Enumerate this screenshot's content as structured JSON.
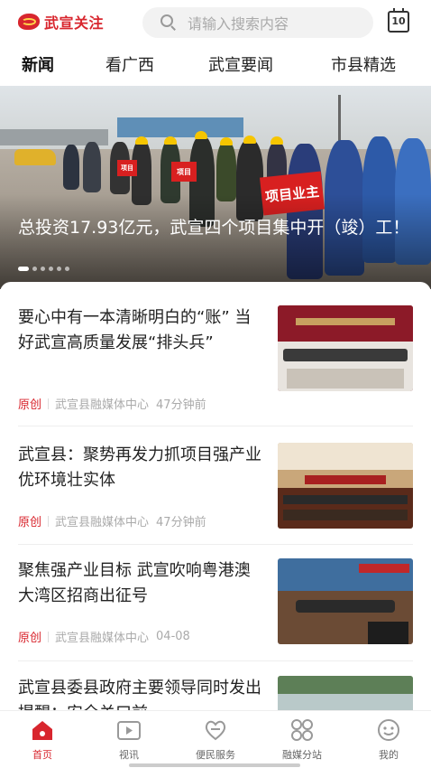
{
  "header": {
    "logo_text": "武宣关注",
    "search_placeholder": "请输入搜索内容",
    "calendar_day": "10"
  },
  "tabs": [
    {
      "label": "新闻",
      "active": true
    },
    {
      "label": "看广西",
      "active": false
    },
    {
      "label": "武宣要闻",
      "active": false
    },
    {
      "label": "市县精选",
      "active": false
    }
  ],
  "hero": {
    "caption": "总投资17.93亿元，武宣四个项目集中开（竣）工！",
    "sign_main": "项目业主",
    "sign_small_1": "项目",
    "sign_small_2": "项目"
  },
  "news": [
    {
      "title": "要心中有一本清晰明白的“账” 当好武宣高质量发展“排头兵”",
      "tag": "原创",
      "source": "武宣县融媒体中心",
      "time": "47分钟前"
    },
    {
      "title": "武宣县：聚势再发力抓项目强产业优环境壮实体",
      "tag": "原创",
      "source": "武宣县融媒体中心",
      "time": "47分钟前"
    },
    {
      "title": "聚焦强产业目标 武宣吹响粤港澳大湾区招商出征号",
      "tag": "原创",
      "source": "武宣县融媒体中心",
      "time": "04-08"
    },
    {
      "title": "武宣县委县政府主要领导同时发出提醒：安全关口前",
      "tag": "",
      "source": "",
      "time": ""
    }
  ],
  "bottom_nav": [
    {
      "label": "首页",
      "icon": "home-icon",
      "active": true
    },
    {
      "label": "视讯",
      "icon": "video-icon",
      "active": false
    },
    {
      "label": "便民服务",
      "icon": "service-icon",
      "active": false
    },
    {
      "label": "融媒分站",
      "icon": "grid-icon",
      "active": false
    },
    {
      "label": "我的",
      "icon": "profile-icon",
      "active": false
    }
  ],
  "colors": {
    "accent": "#d8262e",
    "text": "#222222",
    "meta": "#aaaaaa"
  }
}
